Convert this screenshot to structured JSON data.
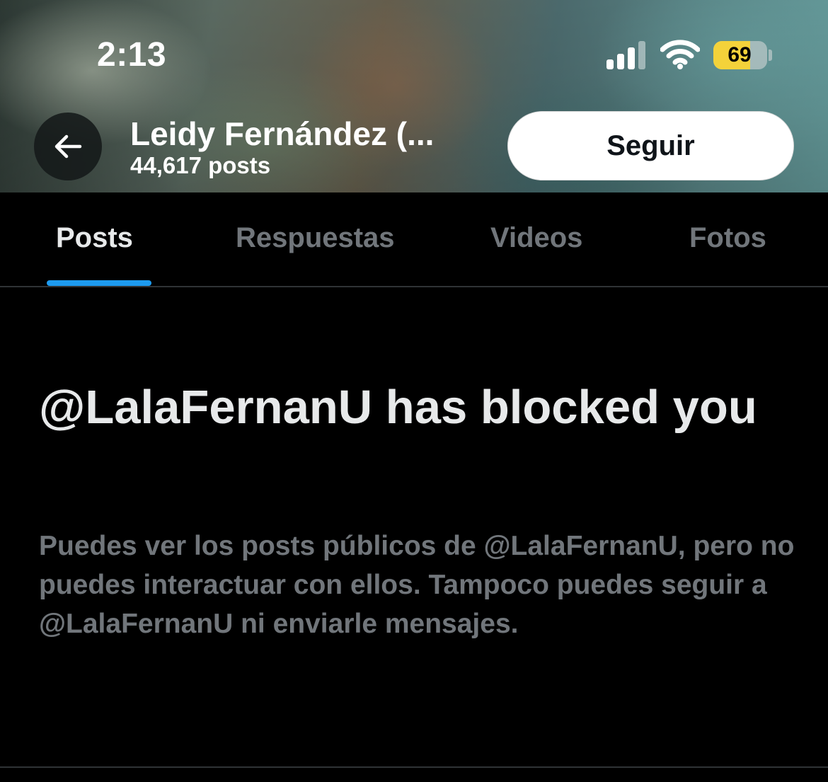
{
  "status_bar": {
    "time": "2:13",
    "battery_percent": "69",
    "battery_level": 0.69
  },
  "header": {
    "back_icon": "arrow-left-icon",
    "profile_name": "Leidy Fernández (...",
    "post_count": "44,617 posts",
    "follow_label": "Seguir"
  },
  "tabs": [
    {
      "label": "Posts",
      "active": true
    },
    {
      "label": "Respuestas",
      "active": false
    },
    {
      "label": "Videos",
      "active": false
    },
    {
      "label": "Fotos",
      "active": false
    }
  ],
  "blocked_notice": {
    "title": "@LalaFernanU has blocked you",
    "description": "Puedes ver los posts públicos de @LalaFernanU, pero no puedes interactuar con ellos. Tampoco puedes seguir a @LalaFernanU ni enviarle mensajes."
  },
  "colors": {
    "background": "#000000",
    "accent": "#1d9bf0",
    "secondary_text": "#71767b",
    "battery": "#f4d23a"
  }
}
